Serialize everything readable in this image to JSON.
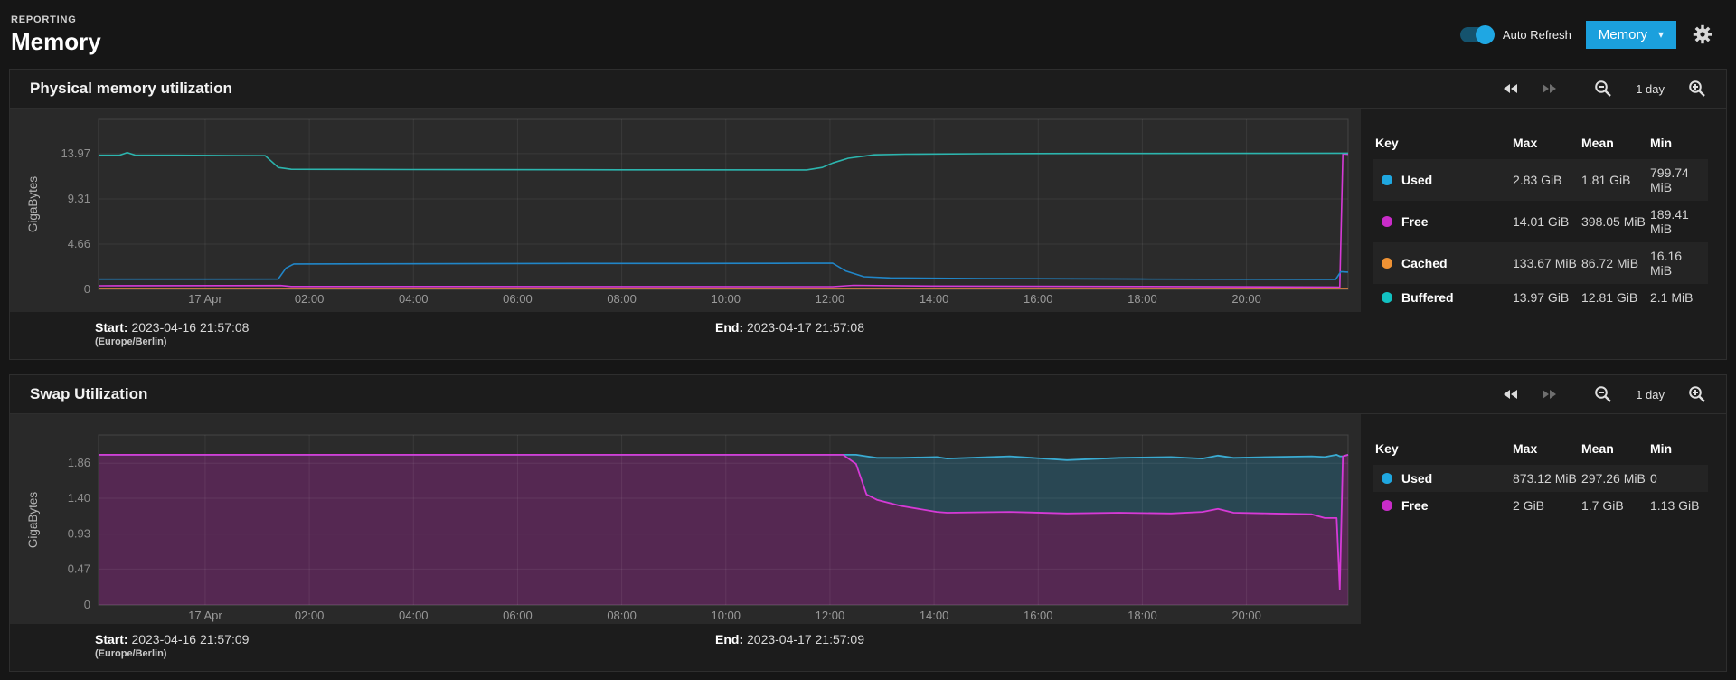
{
  "header": {
    "kicker": "REPORTING",
    "title": "Memory",
    "auto_refresh_label": "Auto Refresh",
    "view_button": "Memory",
    "caret": "▾",
    "accent_color": "#1ba0dd"
  },
  "toolbar": {
    "range_label": "1 day"
  },
  "panels": [
    {
      "title": "Physical memory utilization",
      "ylabel": "GigaBytes",
      "start_label": "Start:",
      "start": "2023-04-16 21:57:08",
      "tz": "(Europe/Berlin)",
      "end_label": "End:",
      "end": "2023-04-17 21:57:08",
      "legend": {
        "headers": [
          "Key",
          "Max",
          "Mean",
          "Min"
        ],
        "rows": [
          {
            "label": "Used",
            "color": "#1fa7e0",
            "max": "2.83 GiB",
            "mean": "1.81 GiB",
            "min": "799.74 MiB"
          },
          {
            "label": "Free",
            "color": "#c92cc9",
            "max": "14.01 GiB",
            "mean": "398.05 MiB",
            "min": "189.41 MiB"
          },
          {
            "label": "Cached",
            "color": "#ef9234",
            "max": "133.67 MiB",
            "mean": "86.72 MiB",
            "min": "16.16 MiB"
          },
          {
            "label": "Buffered",
            "color": "#12c1c1",
            "max": "13.97 GiB",
            "mean": "12.81 GiB",
            "min": "2.1 MiB"
          }
        ]
      }
    },
    {
      "title": "Swap Utilization",
      "ylabel": "GigaBytes",
      "start_label": "Start:",
      "start": "2023-04-16 21:57:09",
      "tz": "(Europe/Berlin)",
      "end_label": "End:",
      "end": "2023-04-17 21:57:09",
      "legend": {
        "headers": [
          "Key",
          "Max",
          "Mean",
          "Min"
        ],
        "rows": [
          {
            "label": "Used",
            "color": "#1fa7e0",
            "max": "873.12 MiB",
            "mean": "297.26 MiB",
            "min": "0"
          },
          {
            "label": "Free",
            "color": "#c92cc9",
            "max": "2 GiB",
            "mean": "1.7 GiB",
            "min": "1.13 GiB"
          }
        ]
      }
    }
  ],
  "chart_data": [
    {
      "type": "line",
      "title": "Physical memory utilization",
      "ylabel": "GigaBytes",
      "y_unit": "GiB",
      "ylim": [
        0,
        17.5
      ],
      "grid": true,
      "legend_position": "right",
      "x_hours": 24,
      "x_start": "2023-04-16 21:57:08",
      "x_end": "2023-04-17 21:57:08",
      "y_ticks": [
        {
          "v": 0,
          "label": "0"
        },
        {
          "v": 4.66,
          "label": "4.66"
        },
        {
          "v": 9.31,
          "label": "9.31"
        },
        {
          "v": 13.97,
          "label": "13.97"
        }
      ],
      "x_ticks": [
        {
          "t": 2.048,
          "label": "17 Apr"
        },
        {
          "t": 4.048,
          "label": "02:00"
        },
        {
          "t": 6.048,
          "label": "04:00"
        },
        {
          "t": 8.048,
          "label": "06:00"
        },
        {
          "t": 10.048,
          "label": "08:00"
        },
        {
          "t": 12.048,
          "label": "10:00"
        },
        {
          "t": 14.048,
          "label": "12:00"
        },
        {
          "t": 16.048,
          "label": "14:00"
        },
        {
          "t": 18.048,
          "label": "16:00"
        },
        {
          "t": 20.048,
          "label": "18:00"
        },
        {
          "t": 22.048,
          "label": "20:00"
        }
      ],
      "series": [
        {
          "name": "Cached",
          "color": "#e8843c",
          "points": [
            [
              0,
              0.09
            ],
            [
              24,
              0.09
            ]
          ]
        },
        {
          "name": "Free",
          "color": "#d63ad6",
          "points": [
            [
              0,
              0.37
            ],
            [
              3.5,
              0.4
            ],
            [
              3.7,
              0.3
            ],
            [
              14.1,
              0.28
            ],
            [
              14.5,
              0.42
            ],
            [
              16,
              0.34
            ],
            [
              20,
              0.3
            ],
            [
              23.7,
              0.24
            ],
            [
              23.84,
              0.22
            ],
            [
              23.9,
              13.95
            ],
            [
              24,
              13.9
            ]
          ]
        },
        {
          "name": "Used",
          "color": "#2186c8",
          "points": [
            [
              0,
              1.05
            ],
            [
              2,
              1.05
            ],
            [
              3.45,
              1.06
            ],
            [
              3.6,
              2.2
            ],
            [
              3.75,
              2.62
            ],
            [
              8,
              2.66
            ],
            [
              13,
              2.68
            ],
            [
              14.1,
              2.7
            ],
            [
              14.35,
              1.9
            ],
            [
              14.7,
              1.3
            ],
            [
              15.2,
              1.18
            ],
            [
              17,
              1.12
            ],
            [
              20,
              1.06
            ],
            [
              23.55,
              1.02
            ],
            [
              23.76,
              1.02
            ],
            [
              23.86,
              1.82
            ],
            [
              24,
              1.78
            ]
          ]
        },
        {
          "name": "Buffered",
          "color": "#2cb5ae",
          "points": [
            [
              0,
              13.8
            ],
            [
              0.4,
              13.8
            ],
            [
              0.55,
              14.08
            ],
            [
              0.7,
              13.82
            ],
            [
              1.5,
              13.8
            ],
            [
              3.2,
              13.76
            ],
            [
              3.45,
              12.55
            ],
            [
              3.7,
              12.36
            ],
            [
              6,
              12.33
            ],
            [
              10,
              12.31
            ],
            [
              13.6,
              12.3
            ],
            [
              13.9,
              12.55
            ],
            [
              14.1,
              13.0
            ],
            [
              14.4,
              13.5
            ],
            [
              14.9,
              13.85
            ],
            [
              15.5,
              13.92
            ],
            [
              17,
              13.96
            ],
            [
              19,
              13.99
            ],
            [
              22,
              14.0
            ],
            [
              24,
              14.02
            ]
          ]
        }
      ]
    },
    {
      "type": "stacked-area",
      "title": "Swap Utilization",
      "ylabel": "GigaBytes",
      "y_unit": "GiB",
      "ylim": [
        0,
        2.23
      ],
      "grid": true,
      "legend_position": "right",
      "x_hours": 24,
      "x_start": "2023-04-16 21:57:09",
      "x_end": "2023-04-17 21:57:09",
      "y_ticks": [
        {
          "v": 0,
          "label": "0"
        },
        {
          "v": 0.47,
          "label": "0.47"
        },
        {
          "v": 0.93,
          "label": "0.93"
        },
        {
          "v": 1.4,
          "label": "1.40"
        },
        {
          "v": 1.86,
          "label": "1.86"
        }
      ],
      "x_ticks": [
        {
          "t": 2.048,
          "label": "17 Apr"
        },
        {
          "t": 4.048,
          "label": "02:00"
        },
        {
          "t": 6.048,
          "label": "04:00"
        },
        {
          "t": 8.048,
          "label": "06:00"
        },
        {
          "t": 10.048,
          "label": "08:00"
        },
        {
          "t": 12.048,
          "label": "10:00"
        },
        {
          "t": 14.048,
          "label": "12:00"
        },
        {
          "t": 16.048,
          "label": "14:00"
        },
        {
          "t": 18.048,
          "label": "16:00"
        },
        {
          "t": 20.048,
          "label": "18:00"
        },
        {
          "t": 22.048,
          "label": "20:00"
        }
      ],
      "t": [
        0,
        6,
        12,
        14.3,
        14.55,
        14.75,
        14.95,
        15.4,
        16.1,
        16.3,
        17.5,
        18.6,
        19.6,
        20.6,
        21.2,
        21.5,
        21.8,
        22.5,
        23.3,
        23.55,
        23.78,
        23.84,
        23.9,
        24
      ],
      "stack": [
        {
          "name": "Free",
          "line_color": "#d63ad6",
          "fill_color": "rgba(182,32,172,0.30)",
          "values": [
            1.97,
            1.97,
            1.97,
            1.97,
            1.85,
            1.45,
            1.38,
            1.3,
            1.22,
            1.21,
            1.22,
            1.2,
            1.21,
            1.2,
            1.22,
            1.26,
            1.21,
            1.2,
            1.19,
            1.14,
            1.14,
            0.2,
            1.95,
            1.97
          ]
        },
        {
          "name": "Used",
          "line_color": "#3aabd2",
          "fill_color": "rgba(38,130,168,0.32)",
          "values": [
            0,
            0,
            0,
            0,
            0.12,
            0.5,
            0.55,
            0.63,
            0.72,
            0.71,
            0.73,
            0.7,
            0.72,
            0.74,
            0.7,
            0.7,
            0.72,
            0.74,
            0.76,
            0.8,
            0.83,
            1.75,
            0,
            0
          ]
        }
      ]
    }
  ]
}
